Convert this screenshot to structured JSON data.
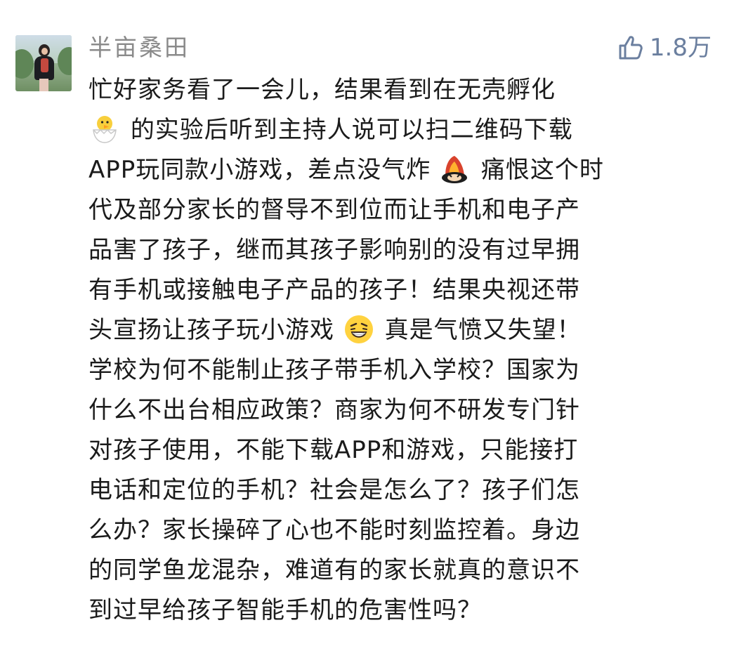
{
  "comment": {
    "user_name": "半亩桑田",
    "likes": "1.8万",
    "lines": [
      {
        "text": "忙好家务看了一会儿，结果看到在无壳孵化"
      },
      {
        "emoji": "hatching-chick-emoji",
        "text": "的实验后听到主持人说可以扫二维码下载"
      },
      {
        "text_before": "APP玩同款小游戏，差点没气炸",
        "emoji": "angry-face-emoji",
        "text_after": "痛恨这个时"
      },
      {
        "text": "代及部分家长的督导不到位而让手机和电子产"
      },
      {
        "text": "品害了孩子，继而其孩子影响别的没有过早拥"
      },
      {
        "text": "有手机或接触电子产品的孩子！结果央视还带"
      },
      {
        "text_before": "头宣扬让孩子玩小游戏",
        "emoji": "frustrated-face-emoji",
        "text_after": "真是气愤又失望！"
      },
      {
        "text": "学校为何不能制止孩子带手机入学校？国家为"
      },
      {
        "text": "什么不出台相应政策？商家为何不研发专门针"
      },
      {
        "text": "对孩子使用，不能下载APP和游戏，只能接打"
      },
      {
        "text": "电话和定位的手机？社会是怎么了？孩子们怎"
      },
      {
        "text": "么办？家长操碎了心也不能时刻监控着。身边"
      },
      {
        "text": "的同学鱼龙混杂，难道有的家长就真的意识不"
      },
      {
        "text": "到过早给孩子智能手机的危害性吗？"
      }
    ]
  },
  "icons": {
    "like": "thumbs-up-icon"
  },
  "colors": {
    "background": "#ffffff",
    "username": "#8a8a8a",
    "text": "#1b1b1b",
    "like": "#6b7f9f"
  }
}
